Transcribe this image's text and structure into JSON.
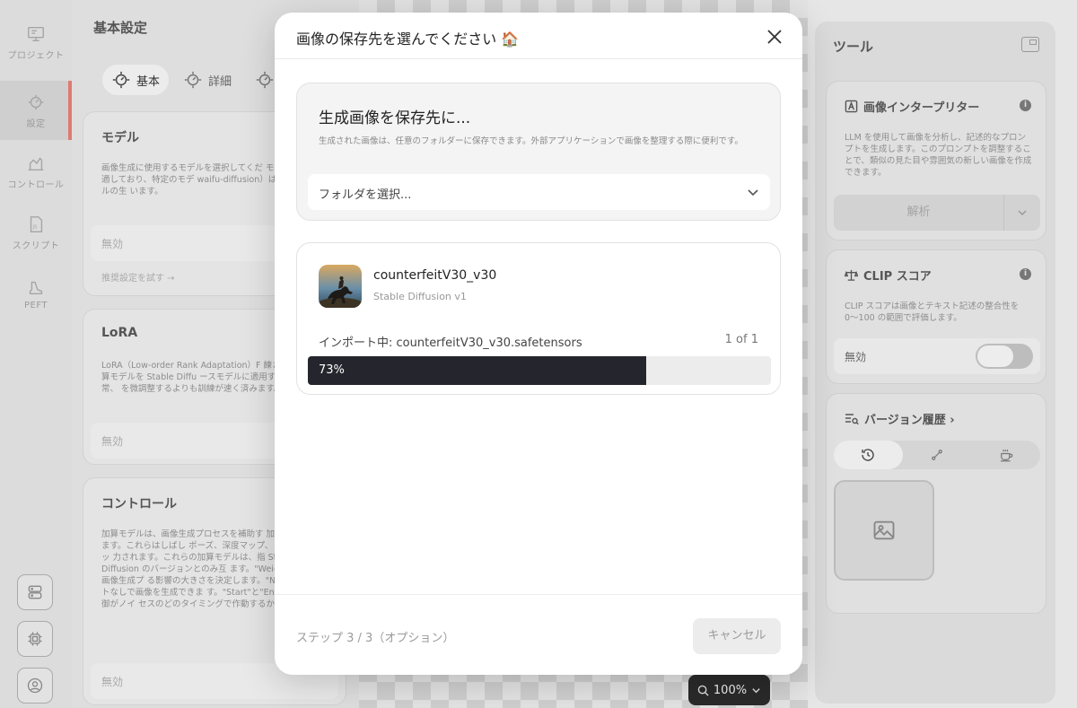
{
  "rail": {
    "items": [
      {
        "label": "プロジェクト",
        "icon": "project-icon"
      },
      {
        "label": "設定",
        "icon": "settings-icon",
        "active": true
      },
      {
        "label": "コントロール",
        "icon": "control-icon"
      },
      {
        "label": "スクリプト",
        "icon": "script-icon"
      },
      {
        "label": "PEFT",
        "icon": "peft-icon"
      }
    ],
    "bottom_buttons": [
      "server-icon",
      "chip-icon",
      "account-icon"
    ]
  },
  "settings": {
    "title": "基本設定",
    "tabs": [
      {
        "label": "基本",
        "active": true
      },
      {
        "label": "詳細"
      },
      {
        "label": ""
      }
    ],
    "model": {
      "title": "モデル",
      "desc": "画像生成に使用するモデルを選択してくだ モデルはすべてに適しており、特定のモデ waifu-diffusion）はアニメスタイルの生 います。",
      "value": "無効",
      "link": "推奨設定を試す →"
    },
    "lora": {
      "title": "LoRA",
      "desc": "LoRA（Low-order Rank Adaptation）F 練された小型の加算モデルを Stable Diffu ースモデルに適用する技術です。通常、 を微調整するよりも訓練が速く済みます。",
      "value": "無効"
    },
    "control": {
      "title": "コントロール",
      "desc": "加算モデルは、画像生成プロセスを補助す 加制御を提供できます。これらはしばし ポーズ、深度マップ、またはエッジマッ 力されます。これらの加算モデルは、指 Stable Diffusion のバージョンとのみ互 ます。\"Weight\"は、制御が画像生成プ る影響の大きさを決定します。\"No Pron ロンプトなしで画像を生成できま す。\"Start\"と\"End\"は、追加制御がノイ セスのどのタイミングで作動するかを決",
      "value": "無効"
    }
  },
  "canvas": {
    "zoom": "100%"
  },
  "tools": {
    "title": "ツール",
    "interpreter": {
      "title": "画像インタープリター",
      "desc": "LLM を使用して画像を分析し、記述的なプロンプトを生成します。このプロンプトを調整することで、類似の見た目や雰囲気の新しい画像を作成できます。",
      "button": "解析"
    },
    "clip": {
      "title": "CLIP スコア",
      "desc": "CLIP スコアは画像とテキスト記述の整合性を 0〜100 の範囲で評価します。",
      "toggle_label": "無効",
      "toggle_on": false
    },
    "history": {
      "title": "バージョン履歴 ›",
      "tabs": [
        "history-icon",
        "branch-icon",
        "coffee-icon"
      ]
    }
  },
  "modal": {
    "title": "画像の保存先を選んでください 🏠",
    "dest_title": "生成画像を保存先に...",
    "dest_desc": "生成された画像は、任意のフォルダーに保存できます。外部アプリケーションで画像を整理する際に便利です。",
    "folder_placeholder": "フォルダを選択...",
    "model_name": "counterfeitV30_v30",
    "model_type": "Stable Diffusion v1",
    "import_label": "インポート中: counterfeitV30_v30.safetensors",
    "import_count": "1 of 1",
    "progress_text": "73%",
    "progress_value": 0.73,
    "step_text": "ステップ 3 / 3（オプション）",
    "cancel_label": "キャンセル"
  },
  "colors": {
    "accent_red": "#e07a70",
    "progress_fill": "#25262d"
  }
}
